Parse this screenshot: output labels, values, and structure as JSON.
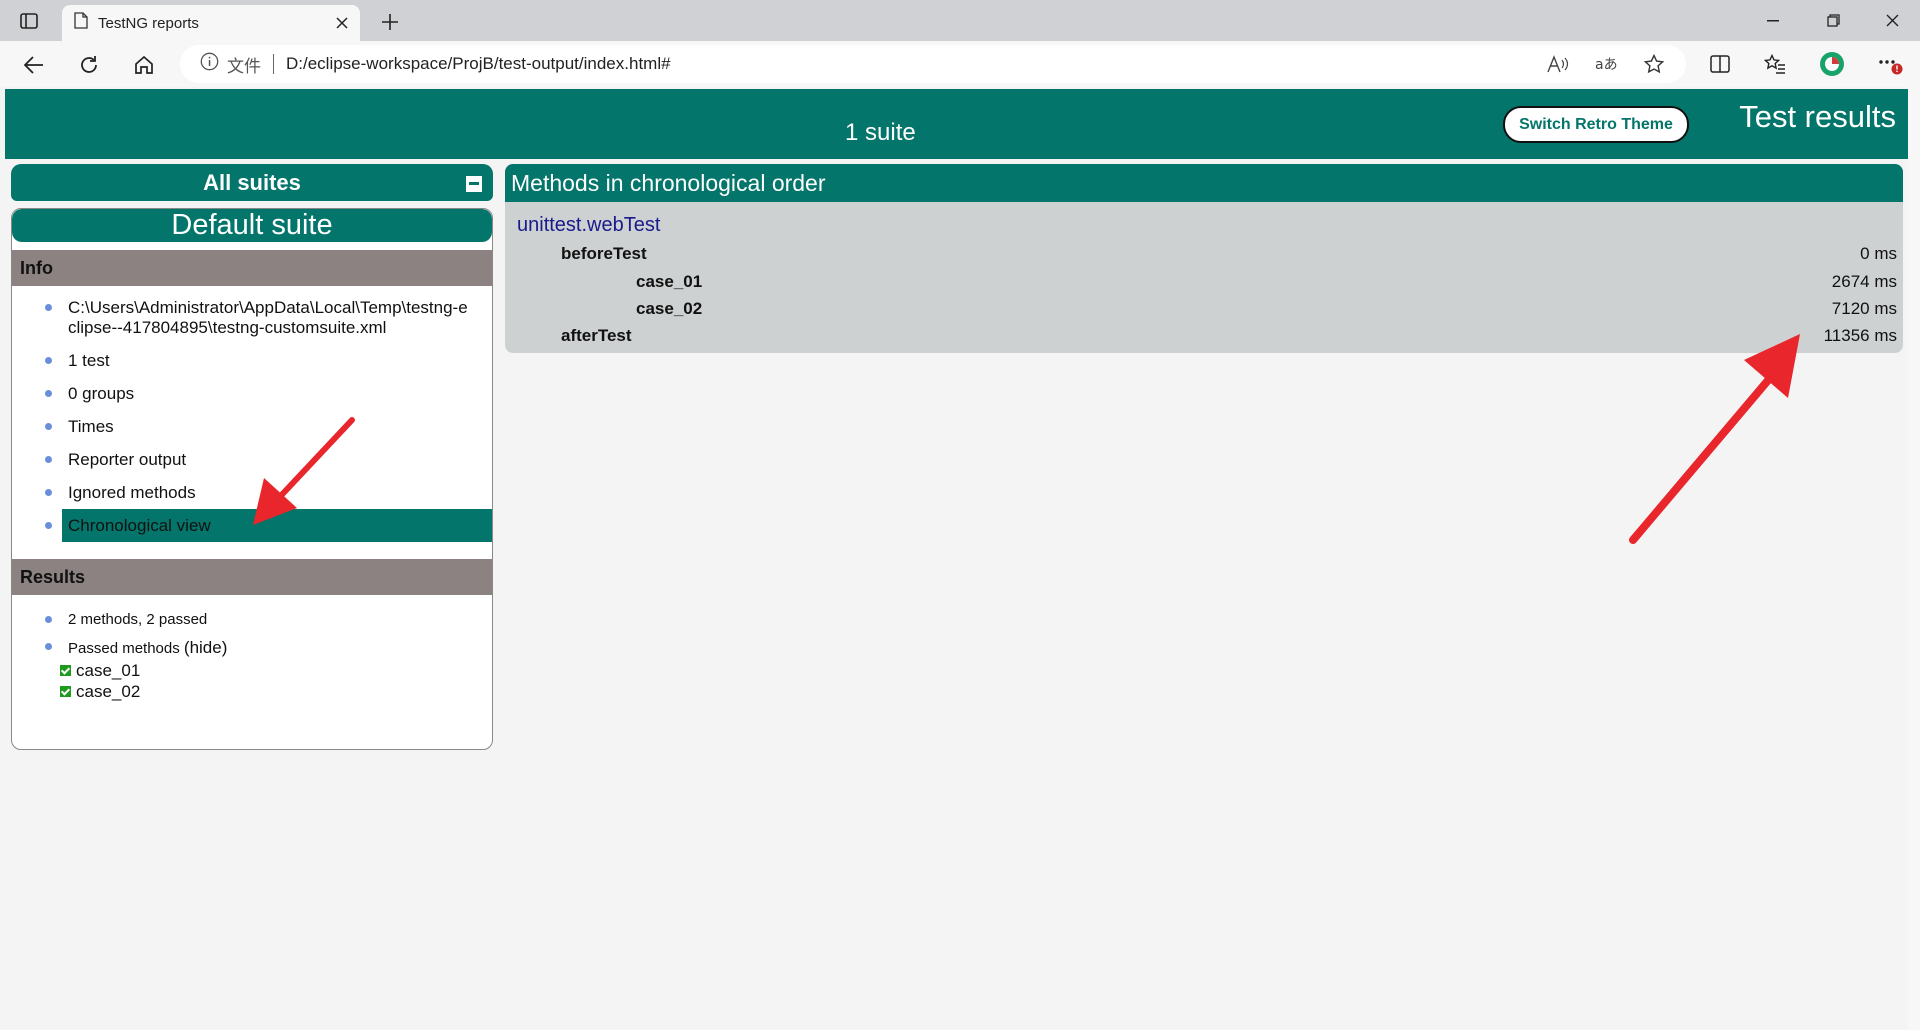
{
  "browser": {
    "tab_title": "TestNG reports",
    "url_label": "文件",
    "url": "D:/eclipse-workspace/ProjB/test-output/index.html#"
  },
  "header": {
    "suite_count": "1 suite",
    "retro_button": "Switch Retro Theme",
    "title": "Test results"
  },
  "sidebar": {
    "all_suites": "All suites",
    "suite_name": "Default suite",
    "info_header": "Info",
    "info_items": [
      {
        "label": "C:\\Users\\Administrator\\AppData\\Local\\Temp\\testng-eclipse--417804895\\testng-customsuite.xml"
      },
      {
        "label": "1 test"
      },
      {
        "label": "0 groups"
      },
      {
        "label": "Times"
      },
      {
        "label": "Reporter output"
      },
      {
        "label": "Ignored methods"
      },
      {
        "label": "Chronological view"
      }
    ],
    "results_header": "Results",
    "summary": "2 methods, 2 passed",
    "passed_label": "Passed methods",
    "hide_link": "(hide)",
    "passed_methods": [
      "case_01",
      "case_02"
    ]
  },
  "main": {
    "header": "Methods in chronological order",
    "class_name": "unittest.webTest",
    "methods": [
      {
        "name": "beforeTest",
        "time": "0 ms"
      },
      {
        "name": "case_01",
        "time": "2674 ms"
      },
      {
        "name": "case_02",
        "time": "7120 ms"
      },
      {
        "name": "afterTest",
        "time": "11356 ms"
      }
    ]
  },
  "colors": {
    "teal": "#03756a",
    "section_gray": "#8c8282",
    "methods_bg": "#cdd1d1",
    "arrow_red": "#e8262c"
  }
}
